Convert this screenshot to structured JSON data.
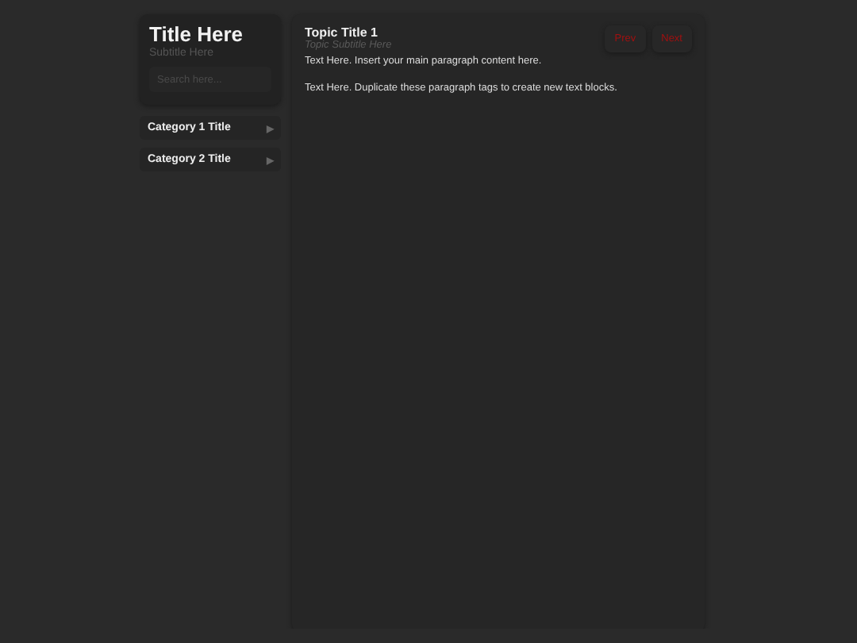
{
  "sidebar": {
    "title": "Title Here",
    "subtitle": "Subtitle Here",
    "search": {
      "placeholder": "Search here..."
    },
    "categories": [
      {
        "label": "Category 1 Title",
        "arrow": "▶"
      },
      {
        "label": "Category 2 Title",
        "arrow": "▶"
      }
    ]
  },
  "main": {
    "title": "Topic Title 1",
    "subtitle": "Topic Subtitle Here",
    "buttons": [
      "Prev",
      "Next"
    ],
    "paragraphs": [
      "Text Here. Insert your main paragraph content here.",
      "Text Here. Duplicate these paragraph tags to create new text blocks."
    ]
  }
}
